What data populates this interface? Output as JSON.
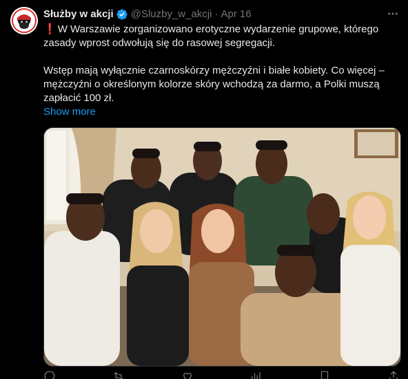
{
  "author": {
    "name": "Służby w akcji",
    "handle": "@Sluzby_w_akcji",
    "separator": "·",
    "date": "Apr 16",
    "verified_color": "#1d9bf0"
  },
  "tweet": {
    "paragraph1_icon": "exclamation-icon",
    "paragraph1": "W Warszawie zorganizowano erotyczne wydarzenie grupowe, którego zasady wprost odwołują się do rasowej segregacji.",
    "paragraph2": "Wstęp mają wyłącznie czarnoskórzy mężczyźni i białe kobiety. Co więcej – mężczyźni o określonym kolorze skóry wchodzą za darmo, a Polki muszą zapłacić 100 zł.",
    "show_more": "Show more"
  },
  "media": {
    "type": "photo",
    "description_icon": "group-photo"
  },
  "actions": [
    {
      "name": "reply-icon"
    },
    {
      "name": "retweet-icon"
    },
    {
      "name": "like-icon"
    },
    {
      "name": "views-icon"
    },
    {
      "name": "bookmark-icon"
    },
    {
      "name": "share-icon"
    }
  ],
  "colors": {
    "background": "#000000",
    "text": "#e7e9ea",
    "muted": "#71767b",
    "link": "#1d9bf0",
    "alert": "#f4212e"
  }
}
